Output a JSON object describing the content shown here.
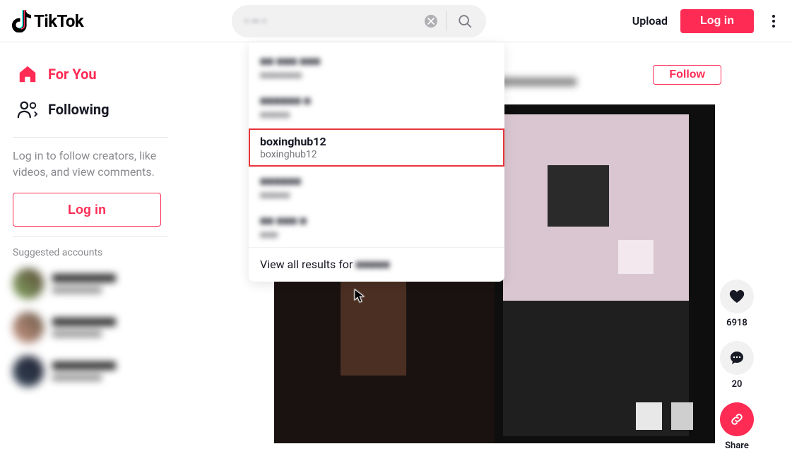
{
  "header": {
    "logo_text": "TikTok",
    "search_value": "- -- -",
    "upload_label": "Upload",
    "login_label": "Log in"
  },
  "dropdown": {
    "items": [
      {
        "title": "■■ ■■■ ■■■",
        "subtitle": "■■■■■■■",
        "blurred": true
      },
      {
        "title": "■■■■■■ ■",
        "subtitle": "■■■■■",
        "blurred": true
      },
      {
        "title": "boxinghub12",
        "subtitle": "boxinghub12",
        "blurred": false,
        "highlighted": true
      },
      {
        "title": "■■■■■■",
        "subtitle": "■■■■■",
        "blurred": true
      },
      {
        "title": "■■ ■■■ ■",
        "subtitle": "■■■",
        "blurred": true
      }
    ],
    "view_all_prefix": "View all results for",
    "view_all_query": "■■■■■"
  },
  "sidebar": {
    "nav": [
      {
        "label": "For You",
        "active": true
      },
      {
        "label": "Following",
        "active": false
      }
    ],
    "login_prompt": "Log in to follow creators, like videos, and view comments.",
    "login_button": "Log in",
    "suggested_title": "Suggested accounts"
  },
  "post": {
    "follow_label": "Follow"
  },
  "actions": {
    "like_count": "6918",
    "comment_count": "20",
    "share_label": "Share"
  },
  "colors": {
    "accent": "#fe2c55"
  }
}
